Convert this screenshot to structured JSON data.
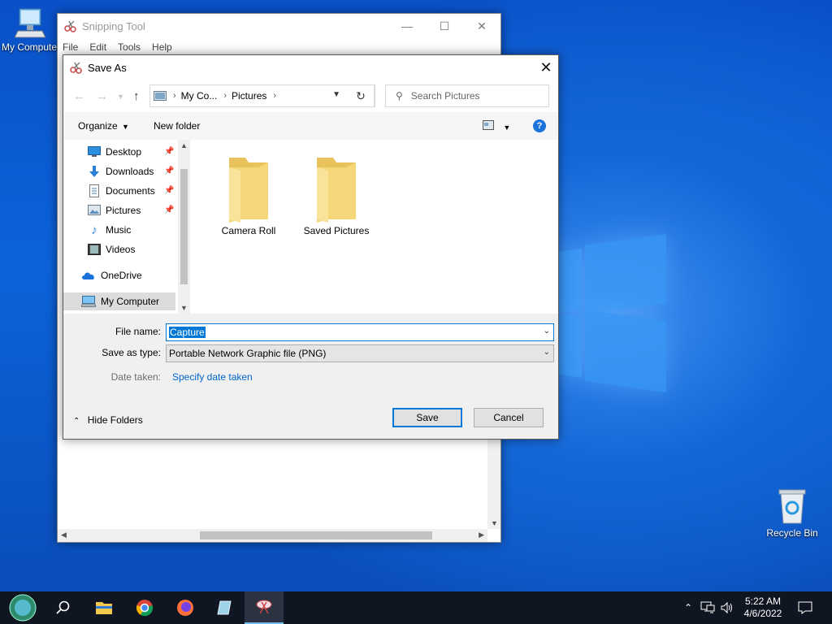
{
  "desktop": {
    "icons": [
      {
        "label": "My Computer"
      },
      {
        "label": "Recycle Bin"
      }
    ]
  },
  "snipping_tool": {
    "title": "Snipping Tool",
    "menu": [
      "File",
      "Edit",
      "Tools",
      "Help"
    ]
  },
  "save_as": {
    "title": "Save As",
    "address": {
      "segments": [
        "My Co...",
        "Pictures"
      ]
    },
    "search_placeholder": "Search Pictures",
    "toolbar": {
      "organize": "Organize",
      "new_folder": "New folder"
    },
    "nav_items": [
      {
        "label": "Desktop",
        "icon": "desktop-icon",
        "pinned": true
      },
      {
        "label": "Downloads",
        "icon": "download-icon",
        "pinned": true
      },
      {
        "label": "Documents",
        "icon": "document-icon",
        "pinned": true
      },
      {
        "label": "Pictures",
        "icon": "pictures-icon",
        "pinned": true
      },
      {
        "label": "Music",
        "icon": "music-icon",
        "pinned": false
      },
      {
        "label": "Videos",
        "icon": "video-icon",
        "pinned": false
      },
      {
        "label": "OneDrive",
        "icon": "cloud-icon",
        "pinned": false
      },
      {
        "label": "My Computer",
        "icon": "computer-icon",
        "pinned": false,
        "selected": true
      }
    ],
    "folders": [
      {
        "name": "Camera Roll"
      },
      {
        "name": "Saved Pictures"
      }
    ],
    "form": {
      "file_name_label": "File name:",
      "file_name_value": "Capture",
      "save_type_label": "Save as type:",
      "save_type_value": "Portable Network Graphic file (PNG)",
      "date_taken_label": "Date taken:",
      "date_taken_link": "Specify date taken"
    },
    "hide_folders": "Hide Folders",
    "save_button": "Save",
    "cancel_button": "Cancel"
  },
  "taskbar": {
    "time": "5:22 AM",
    "date": "4/6/2022"
  },
  "colors": {
    "accent": "#0078d7",
    "link": "#0066cc",
    "selection": "#0078d7",
    "taskbar": "#101522"
  }
}
